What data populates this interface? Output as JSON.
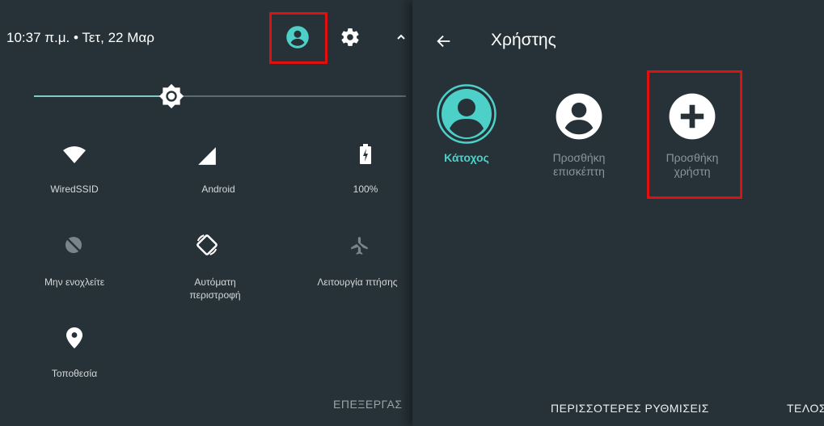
{
  "status_bar": {
    "time_date": "10:37 π.μ. • Τετ, 22 Μαρ",
    "user_icon": "account-circle-icon",
    "settings_icon": "gear-icon",
    "expand_icon": "chevron-up-icon"
  },
  "brightness": {
    "level": 0.37
  },
  "tiles": [
    {
      "label": "WiredSSID",
      "icon": "wifi-icon"
    },
    {
      "label": "Android",
      "icon": "cell-signal-icon"
    },
    {
      "label": "100%",
      "icon": "battery-charging-icon"
    },
    {
      "label": "Μην ενοχλείτε",
      "icon": "do-not-disturb-icon"
    },
    {
      "label": "Αυτόματη περιστροφή",
      "line1": "Αυτόματη",
      "line2": "περιστροφή",
      "icon": "auto-rotate-icon"
    },
    {
      "label": "Λειτουργία πτήσης",
      "icon": "airplane-icon"
    },
    {
      "label": "Τοποθεσία",
      "icon": "location-pin-icon"
    }
  ],
  "left_bottom": {
    "edit": "ΕΠΕΞΕΡΓΑΣ"
  },
  "user_panel": {
    "back_icon": "arrow-back-icon",
    "title": "Χρήστης",
    "users": [
      {
        "label": "Κάτοχος",
        "icon": "account-circle-icon"
      },
      {
        "label": "Προσθήκη επισκέπτη",
        "line1": "Προσθήκη",
        "line2": "επισκέπτη",
        "icon": "account-circle-icon"
      },
      {
        "label": "Προσθήκη χρήστη",
        "line1": "Προσθήκη",
        "line2": "χρήστη",
        "icon": "add-circle-icon"
      }
    ],
    "more_settings": "ΠΕΡΙΣΣΟΤΕΡΕΣ ΡΥΘΜΙΣΕΙΣ",
    "done": "ΤΕΛΟΣ"
  },
  "colors": {
    "background": "#263238",
    "accent": "#80cbc4",
    "active_user": "#4dd0c8",
    "highlight": "#e01010"
  }
}
